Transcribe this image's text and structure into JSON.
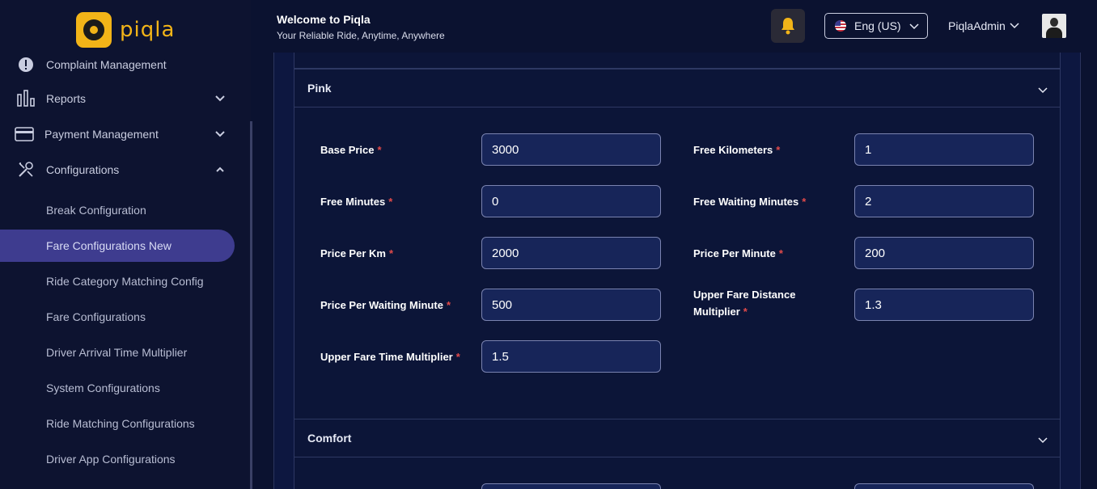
{
  "brand": {
    "name": "piqla"
  },
  "header": {
    "welcome_title": "Welcome to Piqla",
    "welcome_subtitle": "Your Reliable Ride, Anytime, Anywhere",
    "language": "Eng (US)",
    "user_name": "PiqlaAdmin"
  },
  "sidebar": {
    "items": [
      {
        "label": "Complaint Management",
        "icon": "alert-icon"
      },
      {
        "label": "Reports",
        "icon": "bar-chart-icon"
      },
      {
        "label": "Payment Management",
        "icon": "card-icon"
      },
      {
        "label": "Configurations",
        "icon": "tools-icon"
      }
    ],
    "sub_items": [
      "Break Configuration",
      "Fare Configurations New",
      "Ride Category Matching Config",
      "Fare Configurations",
      "Driver Arrival Time Multiplier",
      "System Configurations",
      "Ride Matching Configurations",
      "Driver App Configurations"
    ],
    "active_sub_item": "Fare Configurations New"
  },
  "panels": {
    "pink": {
      "title": "Pink",
      "fields": {
        "base_price": {
          "label": "Base Price",
          "value": "3000"
        },
        "free_kilometers": {
          "label": "Free Kilometers",
          "value": "1"
        },
        "free_minutes": {
          "label": "Free Minutes",
          "value": "0"
        },
        "free_waiting_minutes": {
          "label": "Free Waiting Minutes",
          "value": "2"
        },
        "price_per_km": {
          "label": "Price Per Km",
          "value": "2000"
        },
        "price_per_minute": {
          "label": "Price Per Minute",
          "value": "200"
        },
        "price_per_waiting_minute": {
          "label": "Price Per Waiting Minute",
          "value": "500"
        },
        "upper_fare_distance_multiplier": {
          "label_line1": "Upper Fare Distance",
          "label_line2": "Multiplier",
          "value": "1.3"
        },
        "upper_fare_time_multiplier": {
          "label": "Upper Fare Time Multiplier",
          "value": "1.5"
        }
      }
    },
    "comfort": {
      "title": "Comfort"
    }
  },
  "colors": {
    "accent": "#3e3c8f",
    "brand": "#f2b418",
    "required": "#e24a4a",
    "background": "#0b1230"
  }
}
